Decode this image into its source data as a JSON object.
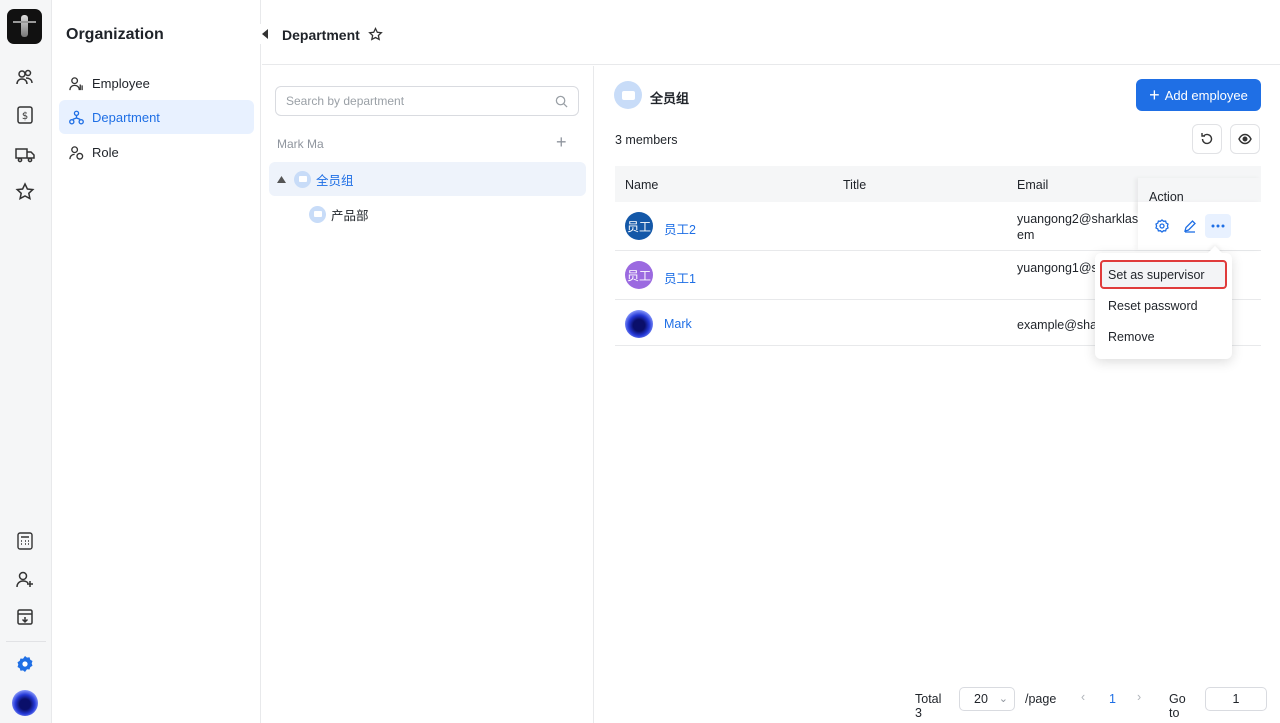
{
  "rail": {
    "icons": [
      "logo",
      "people-icon",
      "billing-icon",
      "truck-icon",
      "star-icon",
      "calculator-icon",
      "add-user-icon",
      "download-icon",
      "settings-icon",
      "profile-avatar"
    ]
  },
  "subnav": {
    "title": "Organization",
    "items": [
      {
        "label": "Employee",
        "icon": "employee-icon"
      },
      {
        "label": "Department",
        "icon": "department-icon",
        "active": true
      },
      {
        "label": "Role",
        "icon": "role-icon"
      }
    ]
  },
  "topbar": {
    "title": "Department"
  },
  "tree": {
    "search_placeholder": "Search by department",
    "owner": "Mark Ma",
    "nodes": [
      {
        "label": "全员组",
        "active": true
      },
      {
        "label": "产品部"
      }
    ]
  },
  "main": {
    "group_name": "全员组",
    "add_button": "Add employee",
    "members_count": "3 members",
    "columns": [
      "Name",
      "Title",
      "Email",
      "Action"
    ],
    "rows": [
      {
        "avatar_text": "员工",
        "avatar_color": "#1458a8",
        "name": "员工2",
        "title": "",
        "email": "yuangong2@sharklasem"
      },
      {
        "avatar_text": "员工",
        "avatar_color": "#9b6ae0",
        "name": "员工1",
        "title": "",
        "email": "yuangong1@sm"
      },
      {
        "avatar_text": "",
        "avatar_color": "#2438d6",
        "name": "Mark",
        "title": "",
        "email": "example@sha"
      }
    ]
  },
  "menu": {
    "items": [
      "Set as supervisor",
      "Reset password",
      "Remove"
    ],
    "highlighted": "Set as supervisor"
  },
  "pagination": {
    "total": "Total 3",
    "page_size": "20",
    "per_page": "/page",
    "current": "1",
    "goto_label": "Go to",
    "goto_value": "1"
  },
  "colors": {
    "accent": "#1f6fe5",
    "highlight_border": "#e03b3b"
  }
}
